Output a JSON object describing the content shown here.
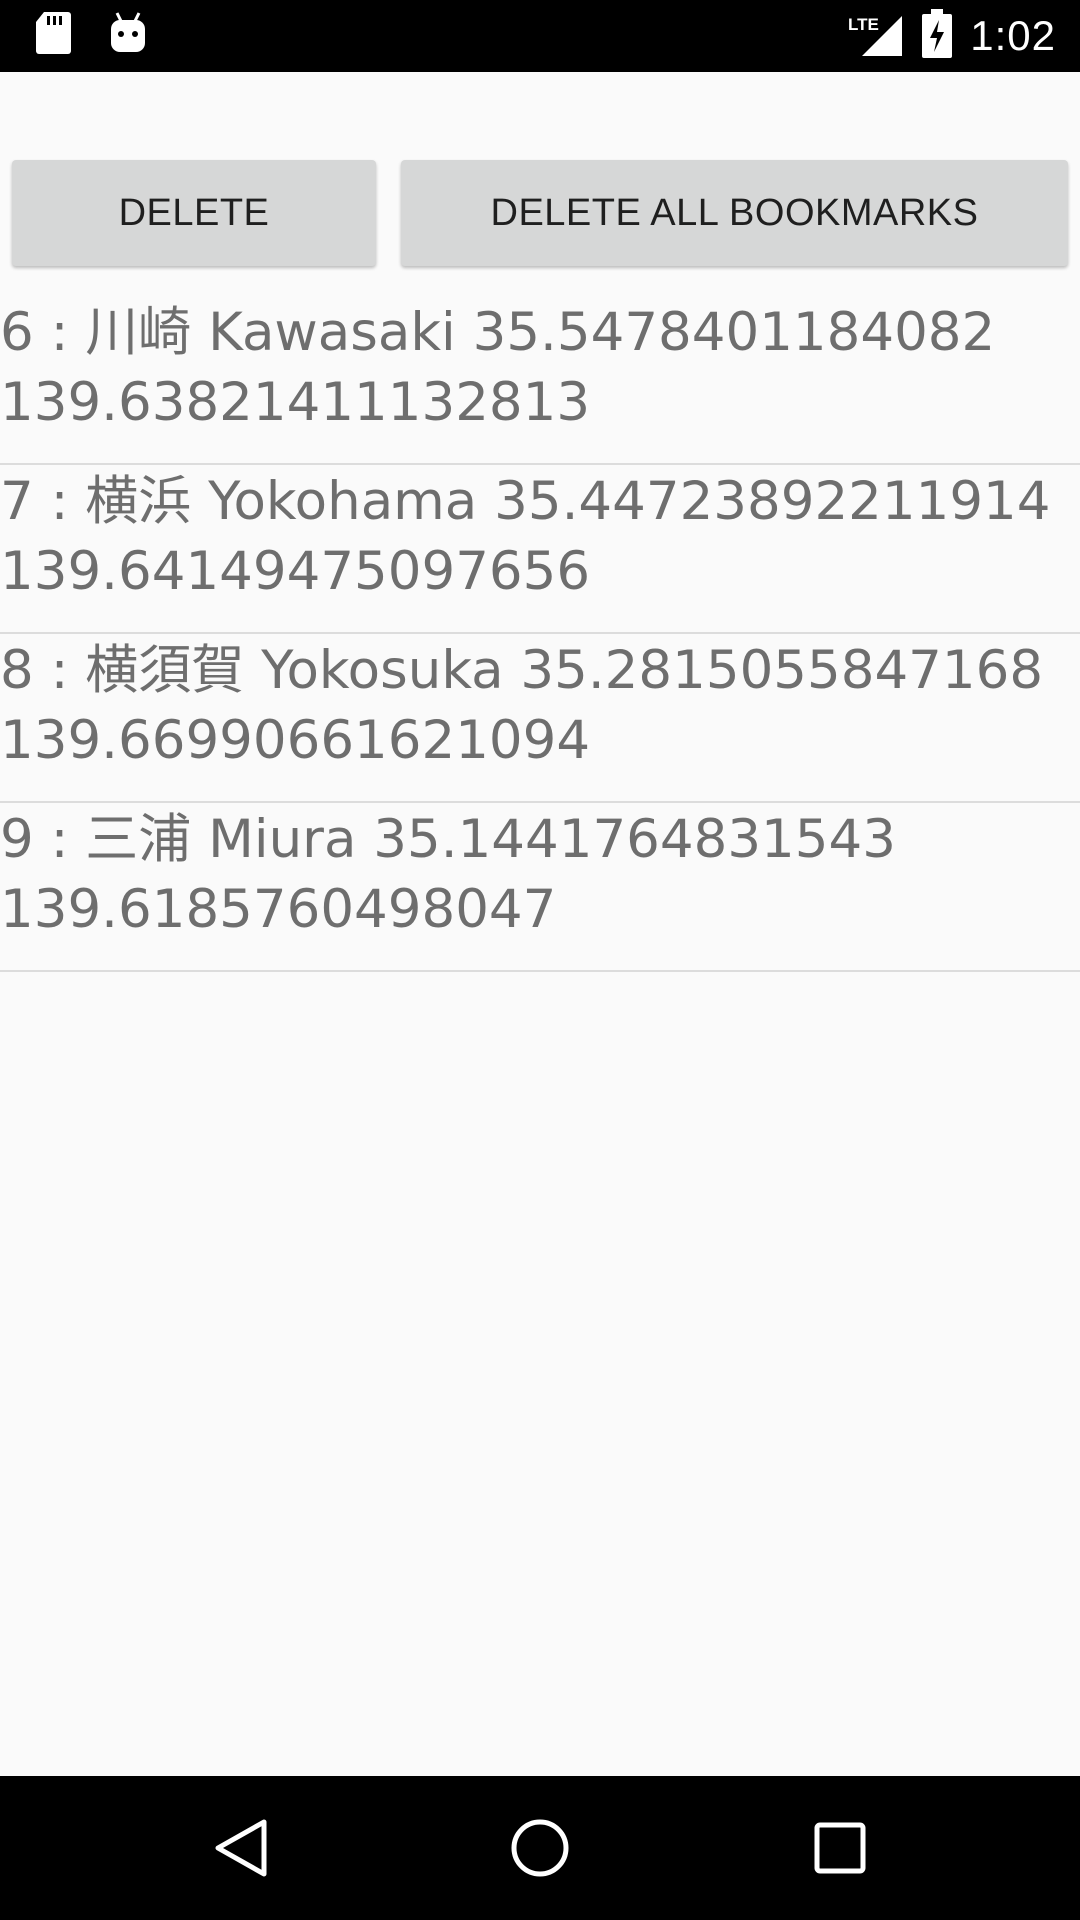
{
  "status_bar": {
    "time": "1:02",
    "network_label": "LTE",
    "left_icons": [
      "sd-card-icon",
      "android-debug-icon"
    ],
    "right_icons": [
      "lte-signal-icon",
      "battery-charging-icon"
    ]
  },
  "buttons": {
    "delete_label": "DELETE",
    "delete_all_label": "DELETE ALL BOOKMARKS"
  },
  "bookmarks": [
    {
      "line1": "6 : 川崎 Kawasaki 35.5478401184082",
      "line2": "139.63821411132813"
    },
    {
      "line1": "7 : 横浜 Yokohama 35.44723892211914",
      "line2": "139.64149475097656"
    },
    {
      "line1": "8 : 横須賀 Yokosuka 35.2815055847168",
      "line2": "139.66990661621094"
    },
    {
      "line1": "9 : 三浦 Miura 35.1441764831543",
      "line2": "139.6185760498047"
    }
  ],
  "nav_bar": {
    "icons": [
      "back-icon",
      "home-icon",
      "recents-icon"
    ]
  },
  "colors": {
    "background": "#fafafa",
    "button_bg": "#d6d7d7",
    "list_text": "#6e6e6e",
    "divider": "#dcdcdc",
    "system_bars": "#000000"
  }
}
